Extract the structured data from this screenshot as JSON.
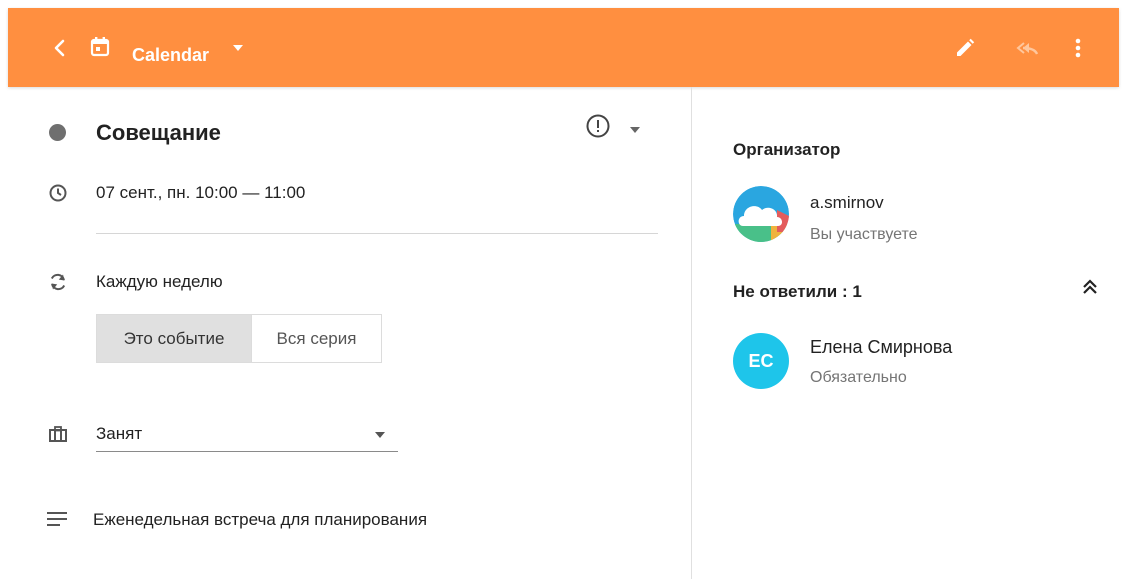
{
  "header": {
    "app_title": "Calendar",
    "bg_color": "#ff8f40",
    "icons": [
      "back-arrow-icon",
      "calendar-icon",
      "chevron-down-icon",
      "edit-icon",
      "reply-all-icon",
      "more-vert-icon"
    ]
  },
  "event": {
    "title": "Совещание",
    "datetime": "07 сент., пн. 10:00 — 11:00",
    "recurrence": "Каждую неделю",
    "scope_options": [
      "Это событие",
      "Вся серия"
    ],
    "availability": "Занят",
    "description": "Еженедельная встреча для планирования"
  },
  "organizer": {
    "heading": "Организатор",
    "name": "a.smirnov",
    "status": "Вы участвуете"
  },
  "attendees": {
    "heading": "Не ответили : 1",
    "items": [
      {
        "initials": "ЕС",
        "name": "Елена Смирнова",
        "role": "Обязательно",
        "color": "#1ec5ea"
      }
    ]
  }
}
